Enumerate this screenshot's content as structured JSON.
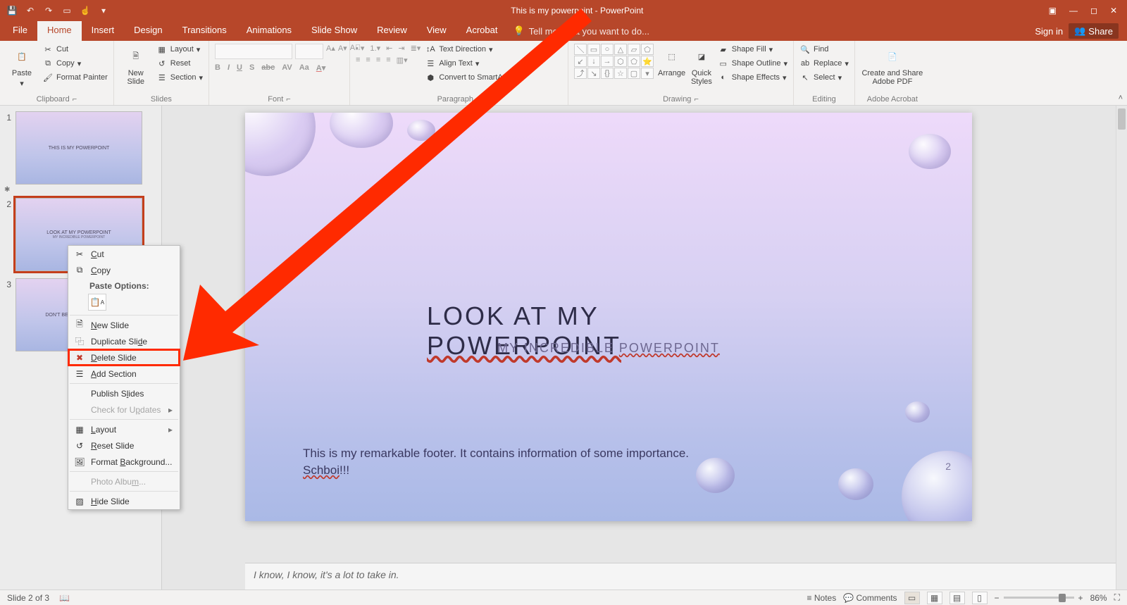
{
  "titlebar": {
    "document_title": "This is my powerpoint - PowerPoint"
  },
  "window_controls": {
    "signin": "Sign in",
    "share": "Share"
  },
  "tabs": {
    "file": "File",
    "home": "Home",
    "insert": "Insert",
    "design": "Design",
    "transitions": "Transitions",
    "animations": "Animations",
    "slideshow": "Slide Show",
    "review": "Review",
    "view": "View",
    "acrobat": "Acrobat",
    "tellme_placeholder": "Tell me what you want to do..."
  },
  "ribbon": {
    "clipboard": {
      "label": "Clipboard",
      "paste": "Paste",
      "cut": "Cut",
      "copy": "Copy",
      "format_painter": "Format Painter"
    },
    "slides": {
      "label": "Slides",
      "new_slide": "New\nSlide",
      "layout": "Layout",
      "reset": "Reset",
      "section": "Section"
    },
    "font": {
      "label": "Font"
    },
    "paragraph": {
      "label": "Paragraph",
      "text_direction": "Text Direction",
      "align_text": "Align Text",
      "smartart": "Convert to SmartArt"
    },
    "drawing": {
      "label": "Drawing",
      "arrange": "Arrange",
      "quick_styles": "Quick\nStyles",
      "shape_fill": "Shape Fill",
      "shape_outline": "Shape Outline",
      "shape_effects": "Shape Effects"
    },
    "editing": {
      "label": "Editing",
      "find": "Find",
      "replace": "Replace",
      "select": "Select"
    },
    "adobe": {
      "label": "Adobe Acrobat",
      "create_share": "Create and Share\nAdobe PDF"
    }
  },
  "thumbnails": [
    {
      "num": "1",
      "title": "THIS IS MY POWERPOINT",
      "sub": ""
    },
    {
      "num": "2",
      "title": "LOOK AT MY POWERPOINT",
      "sub": "MY INCREDIBLE POWERPOINT"
    },
    {
      "num": "3",
      "title": "DON'T BE TOO INTIMIDATED",
      "sub": ""
    }
  ],
  "context_menu": {
    "cut": "Cut",
    "copy": "Copy",
    "paste_options": "Paste Options:",
    "new_slide": "New Slide",
    "duplicate": "Duplicate Slide",
    "delete": "Delete Slide",
    "add_section": "Add Section",
    "publish": "Publish Slides",
    "updates": "Check for Updates",
    "layout": "Layout",
    "reset": "Reset Slide",
    "format_bg": "Format Background...",
    "photo_album": "Photo Album...",
    "hide": "Hide Slide"
  },
  "slide": {
    "title_pre": "LOOK AT MY ",
    "title_wavy": "POWERPOINT",
    "subtitle_pre": "MY INCREDIBLE ",
    "subtitle_wavy": "POWERPOINT",
    "footer_pre": "This is my remarkable footer. It contains information of some importance. ",
    "footer_wavy": "Schboi",
    "footer_post": "!!!",
    "page_number": "2"
  },
  "notes": {
    "text": "I know, I know, it's a lot to take in."
  },
  "statusbar": {
    "slide_indicator": "Slide 2 of 3",
    "notes": "Notes",
    "comments": "Comments",
    "zoom": "86%"
  }
}
